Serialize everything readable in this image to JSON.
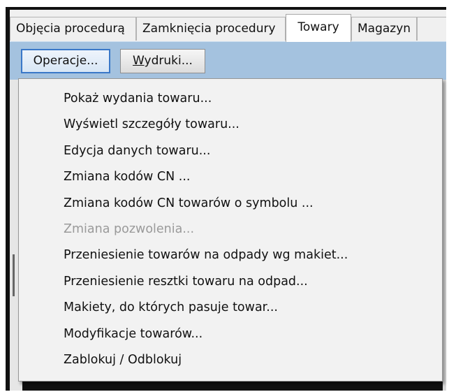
{
  "tabs": [
    {
      "label": "Objęcia procedurą",
      "active": false
    },
    {
      "label": "Zamknięcia procedury",
      "active": false
    },
    {
      "label": "Towary",
      "active": true
    },
    {
      "label": "Magazyn",
      "active": false
    }
  ],
  "toolbar": {
    "operations_label": "Operacje...",
    "printouts_label": "Wydruki..."
  },
  "menu": {
    "items": [
      {
        "label": "Pokaż wydania towaru...",
        "enabled": true
      },
      {
        "label": "Wyświetl szczegóły towaru...",
        "enabled": true
      },
      {
        "label": "Edycja danych towaru...",
        "enabled": true
      },
      {
        "label": "Zmiana kodów CN ...",
        "enabled": true
      },
      {
        "label": "Zmiana kodów CN towarów o symbolu ...",
        "enabled": true
      },
      {
        "label": "Zmiana pozwolenia...",
        "enabled": false
      },
      {
        "label": "Przeniesienie towarów na odpady wg makiet...",
        "enabled": true
      },
      {
        "label": "Przeniesienie resztki towaru na odpad...",
        "enabled": true
      },
      {
        "label": "Makiety, do których pasuje towar...",
        "enabled": true
      },
      {
        "label": "Modyfikacje towarów...",
        "enabled": true
      },
      {
        "label": "Zablokuj / Odblokuj",
        "enabled": true
      }
    ]
  },
  "colors": {
    "toolbar_bg": "#a4c2df",
    "menu_bg": "#f2f2f2",
    "disabled_text": "#9a9a9a",
    "focus_border": "#3a78c8"
  }
}
